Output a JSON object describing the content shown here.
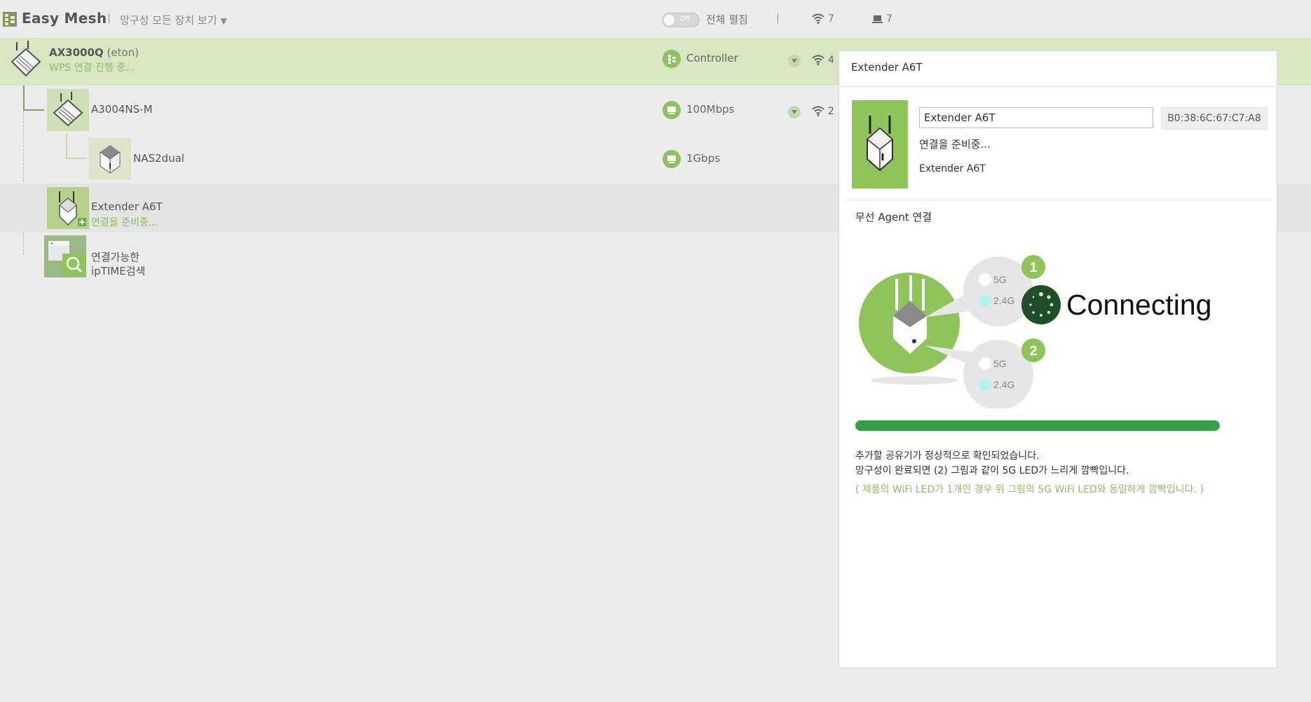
{
  "header": {
    "brand": "Easy Mesh",
    "view_all": "망구성 모든 장치 보기",
    "toggle_state": "Off",
    "expand_all": "전체 펼침",
    "wifi_count": "7",
    "wired_count": "7"
  },
  "tree": {
    "root": {
      "name": "AX3000Q",
      "owner": "(eton)",
      "status": "WPS 연결 진행 중...",
      "link": "Controller",
      "wifi": "4"
    },
    "node1": {
      "name": "A3004NS-M",
      "link": "100Mbps",
      "wifi": "2"
    },
    "node2": {
      "name": "NAS2dual",
      "link": "1Gbps"
    },
    "extender": {
      "name": "Extender A6T",
      "status": "연결을 준비중..."
    },
    "search": {
      "line1": "연결가능한",
      "line2": "ipTIME검색"
    }
  },
  "panel": {
    "title": "Extender A6T",
    "name_value": "Extender A6T",
    "mac": "B0:38:6C:67:C7:A8",
    "status": "연결을 준비중...",
    "model": "Extender A6T",
    "section": "무선 Agent 연결",
    "illustration": {
      "step1": "1",
      "step2": "2",
      "band_5g": "5G",
      "band_24g": "2.4G",
      "connecting": "Connecting"
    },
    "progress": 1.0,
    "message1": "추가할 공유기가 정상적으로 확인되었습니다.",
    "message2": "망구성이 완료되면 (2) 그림과 같이 5G LED가 느리게 깜빡입니다.",
    "note": "( 제품의 WiFi LED가 1개인 경우 위 그림의 5G WiFi LED와 동일하게 깜빡입니다. )"
  },
  "colors": {
    "accent_green": "#8fc45a",
    "progress_green": "#369f4c",
    "status_green": "#8fbd63",
    "root_row_bg": "#d8e6c4"
  }
}
